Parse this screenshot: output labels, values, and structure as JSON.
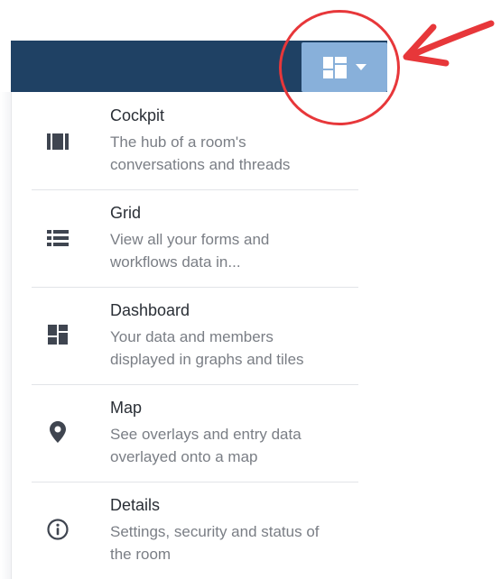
{
  "toolbar": {
    "view_switcher_icon": "dashboard-icon",
    "dropdown_icon": "caret-down-icon",
    "bar_color": "#1f4164",
    "button_color": "#88b0da"
  },
  "menu": {
    "items": [
      {
        "icon": "cockpit-icon",
        "title": "Cockpit",
        "desc_line1": "The hub of a room's",
        "desc_line2": "conversations and threads"
      },
      {
        "icon": "grid-list-icon",
        "title": "Grid",
        "desc_line1": "View all your forms and",
        "desc_line2": "workflows data in..."
      },
      {
        "icon": "dashboard-icon",
        "title": "Dashboard",
        "desc_line1": "Your data and members",
        "desc_line2": "displayed in graphs and tiles"
      },
      {
        "icon": "map-pin-icon",
        "title": "Map",
        "desc_line1": "See overlays and entry data",
        "desc_line2": "overlayed onto a map"
      },
      {
        "icon": "info-icon",
        "title": "Details",
        "desc_line1": "Settings, security and status of",
        "desc_line2": "the room"
      }
    ]
  },
  "annotation": {
    "color": "#e7373a"
  }
}
